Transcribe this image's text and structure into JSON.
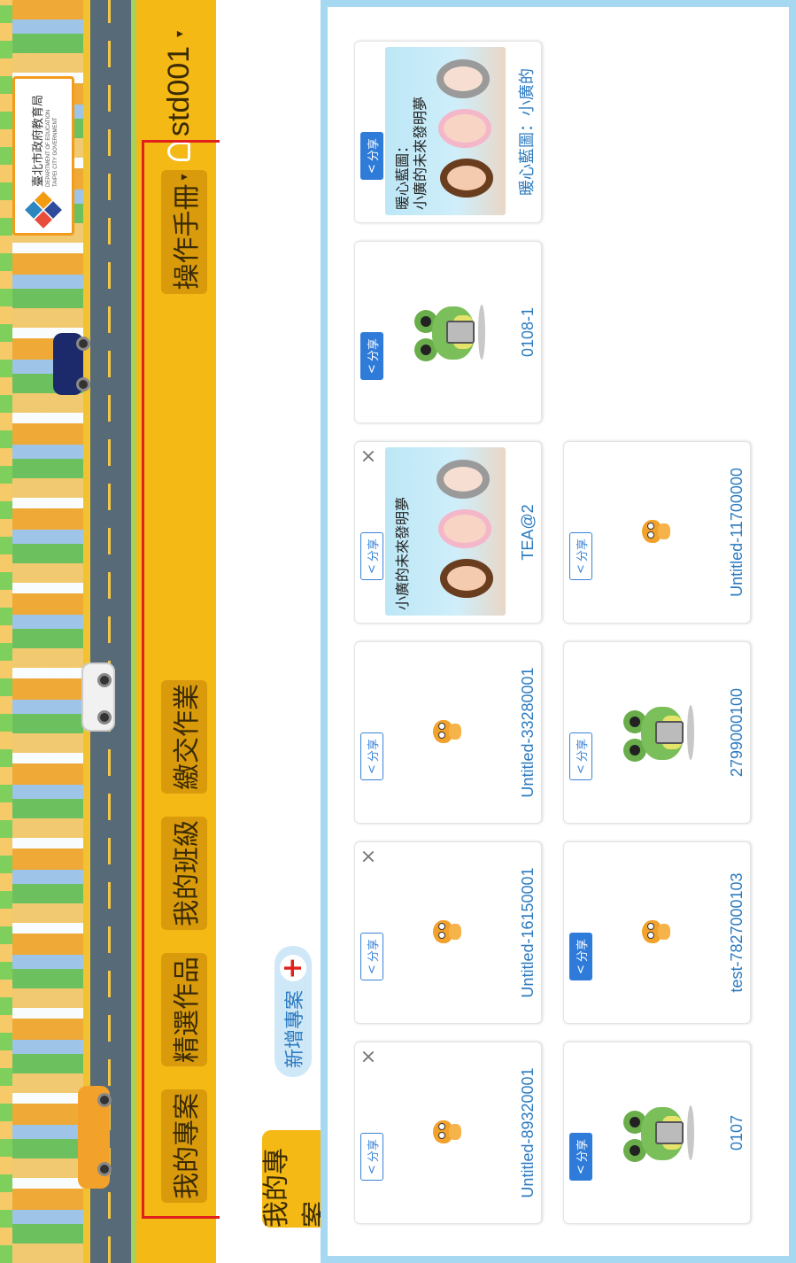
{
  "banner": {
    "logo_zh": "臺北市政府教育局",
    "logo_en_1": "DEPARTMENT OF EDUCATION",
    "logo_en_2": "TAIPEI CITY GOVERNMENT"
  },
  "nav": {
    "items": [
      {
        "label": "我的專案"
      },
      {
        "label": "精選作品"
      },
      {
        "label": "我的班級"
      },
      {
        "label": "繳交作業"
      },
      {
        "label": "操作手冊"
      }
    ],
    "manual_caret": "▾",
    "user_name": "std001",
    "user_caret": "▾"
  },
  "section": {
    "tab_label": "我的專案",
    "new_project_label": "新增專案",
    "new_project_plus": "+"
  },
  "share_label": "分享",
  "close_glyph": "×",
  "projects": [
    {
      "title": "Untitled-89320001",
      "thumb": "scratch-cat",
      "share_style": "outline",
      "deletable": true
    },
    {
      "title": "Untitled-16150001",
      "thumb": "scratch-cat",
      "share_style": "outline",
      "deletable": true
    },
    {
      "title": "Untitled-33280001",
      "thumb": "scratch-cat",
      "share_style": "outline",
      "deletable": false
    },
    {
      "title": "TEA@2",
      "thumb": "scene",
      "scene_text": "小廣的未來發明夢",
      "share_style": "outline",
      "deletable": true
    },
    {
      "title": "0108-1",
      "thumb": "frog",
      "share_style": "solid",
      "deletable": false
    },
    {
      "title": "暖心藍圖：小廣的",
      "thumb": "scene",
      "scene_text": "暖心藍圖：\n小廣的未來發明夢",
      "share_style": "solid",
      "deletable": false
    },
    {
      "title": "0107",
      "thumb": "frog",
      "share_style": "solid",
      "deletable": false
    },
    {
      "title": "test-7827000103",
      "thumb": "scratch-cat",
      "share_style": "solid",
      "deletable": false
    },
    {
      "title": "2799000100",
      "thumb": "frog",
      "share_style": "outline",
      "deletable": false
    },
    {
      "title": "Untitled-11700000",
      "thumb": "scratch-cat",
      "share_style": "outline",
      "deletable": false
    }
  ],
  "colors": {
    "nav_bg": "#f4b914",
    "nav_button": "#d99b0c",
    "highlight": "#e0201c",
    "panel_border": "#a7d8f1",
    "link_blue": "#2b7ac0"
  }
}
